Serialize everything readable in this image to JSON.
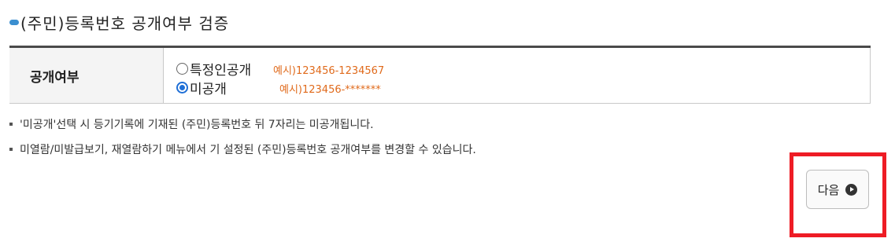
{
  "section": {
    "title": "(주민)등록번호 공개여부 검증"
  },
  "form": {
    "field_label": "공개여부",
    "options": [
      {
        "label": "특정인공개",
        "example": "예시)123456-1234567",
        "checked": false
      },
      {
        "label": "미공개",
        "example": "예시)123456-*******",
        "checked": true
      }
    ]
  },
  "notes": [
    "'미공개'선택 시 등기기록에 기재된 (주민)등록번호 뒤 7자리는 미공개됩니다.",
    "미열람/미발급보기, 재열람하기 메뉴에서 기 설정된 (주민)등록번호 공개여부를 변경할 수 있습니다."
  ],
  "actions": {
    "next_label": "다음",
    "next_icon": "circle-arrow-right-icon"
  },
  "colors": {
    "accent_blue": "#3b8fd0",
    "example_orange": "#e06a1b",
    "highlight_red": "#ee1c25"
  }
}
